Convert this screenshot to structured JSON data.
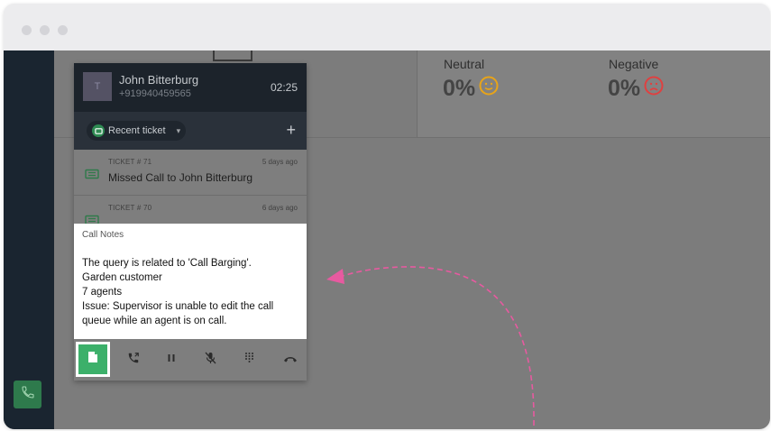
{
  "stats": {
    "neutral": {
      "label": "Neutral",
      "value": "0%"
    },
    "negative": {
      "label": "Negative",
      "value": "0%"
    }
  },
  "caller": {
    "avatar_initial": "T",
    "name": "John Bitterburg",
    "number": "+919940459565",
    "timer": "02:25"
  },
  "tab": {
    "label": "Recent ticket",
    "add": "+"
  },
  "tickets": [
    {
      "id": "TICKET # 71",
      "age": "5 days ago",
      "title": "Missed Call to John Bitterburg"
    },
    {
      "id": "TICKET # 70",
      "age": "6 days ago",
      "title": ""
    }
  ],
  "notes": {
    "title": "Call Notes",
    "lines": [
      "The query is related to 'Call Barging'.",
      "Garden customer",
      "7 agents",
      "Issue: Supervisor is unable to edit the call",
      "queue while an agent is on call."
    ]
  },
  "colors": {
    "accent_green": "#3cb06a",
    "arrow": "#e75aa0",
    "header_dark": "#1c232b",
    "face_neutral": "#e8a418",
    "face_negative": "#e04040"
  },
  "icons": [
    "phone-icon",
    "ticket-icon",
    "note-icon",
    "transfer-icon",
    "pause-icon",
    "mute-icon",
    "keypad-icon",
    "hangup-icon",
    "smiley-neutral-icon",
    "smiley-negative-icon"
  ]
}
